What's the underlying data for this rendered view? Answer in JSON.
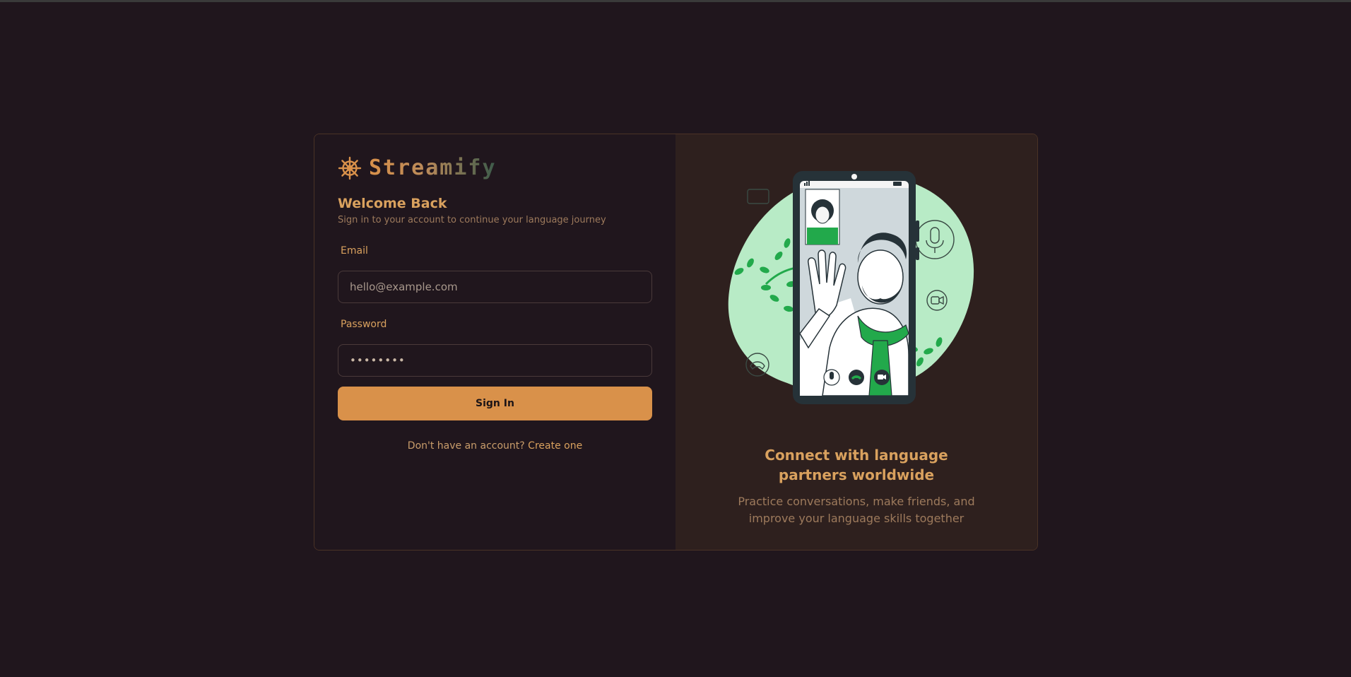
{
  "brand": {
    "name": "Streamify",
    "icon": "ship-wheel-icon"
  },
  "login": {
    "title": "Welcome Back",
    "subtitle": "Sign in to your account to continue your language journey",
    "email_label": "Email",
    "email_placeholder": "hello@example.com",
    "password_label": "Password",
    "password_value": "••••••••",
    "submit_label": "Sign In",
    "footer_text": "Don't have an account?",
    "footer_link": "Create one"
  },
  "promo": {
    "title": "Connect with language partners worldwide",
    "subtitle": "Practice conversations, make friends, and improve your language skills together"
  },
  "colors": {
    "background": "#20161d",
    "accent": "#d9914a",
    "panel": "#2e201e",
    "illustration_green": "#22a94b"
  }
}
